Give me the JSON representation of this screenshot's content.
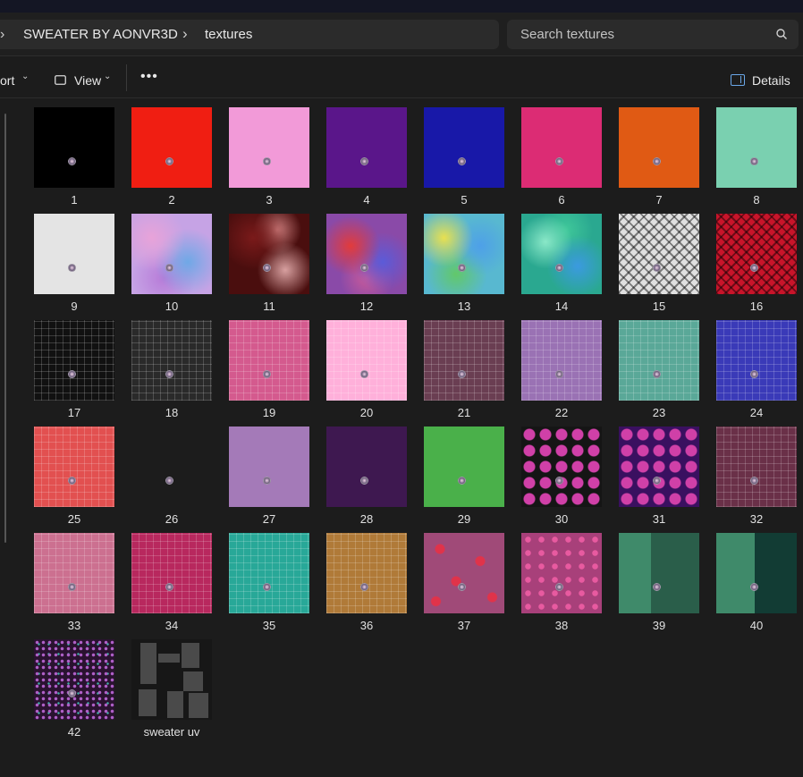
{
  "breadcrumb": {
    "items": [
      "SWEATER BY AONVR3D",
      "textures"
    ]
  },
  "search": {
    "placeholder": "Search textures"
  },
  "toolbar": {
    "sort_label": "ort",
    "view_label": "View",
    "more_label": "•••",
    "details_label": "Details"
  },
  "icons": {
    "search": "search-icon",
    "chevron": "chevron-right-icon",
    "view": "view-icon",
    "details": "details-pane-icon"
  },
  "files": [
    {
      "name": "1",
      "color": "#000000"
    },
    {
      "name": "2",
      "color": "#f01e12"
    },
    {
      "name": "3",
      "color": "#f29ad8"
    },
    {
      "name": "4",
      "color": "#5a168a"
    },
    {
      "name": "5",
      "color": "#1818a8"
    },
    {
      "name": "6",
      "color": "#dc2c74"
    },
    {
      "name": "7",
      "color": "#e05a14"
    },
    {
      "name": "8",
      "color": "#7ad0b0"
    },
    {
      "name": "9",
      "color": "#e4e4e4"
    },
    {
      "name": "10",
      "color": "#c6a3e5"
    },
    {
      "name": "11",
      "color": "#4a0e0e"
    },
    {
      "name": "12",
      "color": "#8a4aa8"
    },
    {
      "name": "13",
      "color": "#58b8d0"
    },
    {
      "name": "14",
      "color": "#2aa890"
    },
    {
      "name": "15",
      "color": "#e0e0e0"
    },
    {
      "name": "16",
      "color": "#c8142a"
    },
    {
      "name": "17",
      "color": "#111111"
    },
    {
      "name": "18",
      "color": "#2a2a2a"
    },
    {
      "name": "19",
      "color": "#d45a8e"
    },
    {
      "name": "20",
      "color": "#ffb0da"
    },
    {
      "name": "21",
      "color": "#6a3e52"
    },
    {
      "name": "22",
      "color": "#9a72b4"
    },
    {
      "name": "23",
      "color": "#5aa898"
    },
    {
      "name": "24",
      "color": "#3a3ab8"
    },
    {
      "name": "25",
      "color": "#e25050"
    },
    {
      "name": "26",
      "color": "#1c1c1c"
    },
    {
      "name": "27",
      "color": "#a47ab8"
    },
    {
      "name": "28",
      "color": "#3e1850"
    },
    {
      "name": "29",
      "color": "#4ab04a"
    },
    {
      "name": "30",
      "color": "#151515"
    },
    {
      "name": "31",
      "color": "#3a1060"
    },
    {
      "name": "32",
      "color": "#6a3048"
    },
    {
      "name": "33",
      "color": "#cc7090"
    },
    {
      "name": "34",
      "color": "#b8285e"
    },
    {
      "name": "35",
      "color": "#28a898"
    },
    {
      "name": "36",
      "color": "#b07a38"
    },
    {
      "name": "37",
      "color": "#a04a78"
    },
    {
      "name": "38",
      "color": "#a8407a"
    },
    {
      "name": "39",
      "color": "#3f8a6a"
    },
    {
      "name": "40",
      "color": "#3f8a6a"
    },
    {
      "name": "42",
      "color": "#2a1230"
    },
    {
      "name": "sweater uv",
      "color": "#171717"
    }
  ]
}
